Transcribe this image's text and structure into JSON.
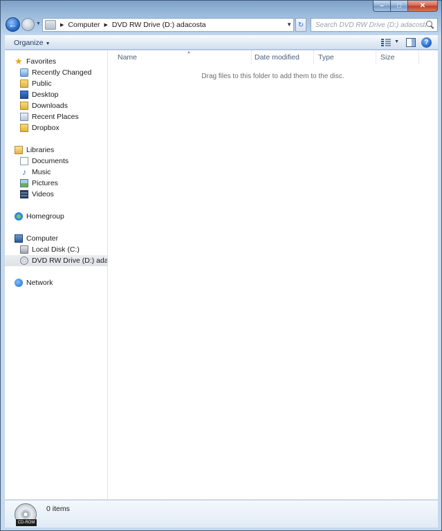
{
  "window": {
    "caption_buttons": {
      "minimize": "–",
      "maximize": "□",
      "close": "✕"
    }
  },
  "nav": {
    "back_glyph": "←",
    "forward_glyph": "→",
    "breadcrumbs": [
      "Computer",
      "DVD RW Drive (D:) adacosta"
    ],
    "refresh_glyph": "↻",
    "search_placeholder": "Search DVD RW Drive (D:) adacosta"
  },
  "toolbar": {
    "organize_label": "Organize",
    "help_glyph": "?"
  },
  "sidebar": {
    "favorites": {
      "label": "Favorites",
      "items": [
        "Recently Changed",
        "Public",
        "Desktop",
        "Downloads",
        "Recent Places",
        "Dropbox"
      ]
    },
    "libraries": {
      "label": "Libraries",
      "items": [
        "Documents",
        "Music",
        "Pictures",
        "Videos"
      ]
    },
    "homegroup": "Homegroup",
    "computer": {
      "label": "Computer",
      "items": [
        "Local Disk (C:)",
        "DVD RW Drive (D:) adacosta"
      ]
    },
    "network": "Network",
    "selected": "DVD RW Drive (D:) adacosta"
  },
  "file_list": {
    "columns": [
      "Name",
      "Date modified",
      "Type",
      "Size"
    ],
    "empty_message": "Drag files to this folder to add them to the disc."
  },
  "details": {
    "icon_label": "CD-ROM",
    "item_count": "0 items"
  }
}
